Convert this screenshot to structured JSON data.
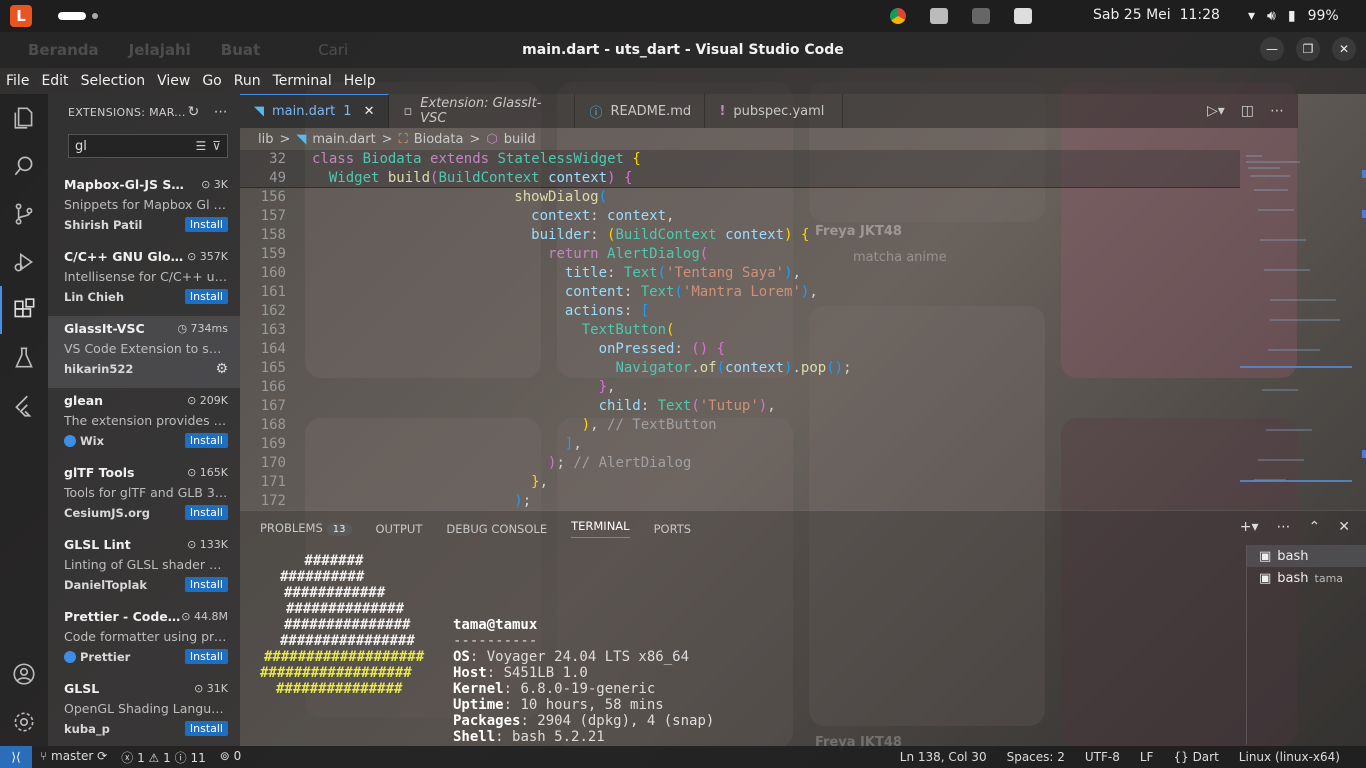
{
  "system_bar": {
    "date": "Sab 25 Mei",
    "time": "11:28",
    "battery": "99%"
  },
  "window": {
    "title": "main.dart - uts_dart - Visual Studio Code",
    "background_nav": [
      "Beranda",
      "Jelajahi",
      "Buat",
      "Cari"
    ],
    "background_names": [
      "Freya JKT48",
      "matcha anime",
      "Freya JKT48"
    ]
  },
  "menu": [
    "File",
    "Edit",
    "Selection",
    "View",
    "Go",
    "Run",
    "Terminal",
    "Help"
  ],
  "sidebar": {
    "title": "EXTENSIONS: MAR...",
    "search_value": "gl",
    "extensions": [
      {
        "name": "Mapbox-Gl-JS Sni...",
        "count": "3K",
        "desc": "Snippets for Mapbox Gl J...",
        "publisher": "Shirish Patil",
        "action": "Install",
        "verified": false
      },
      {
        "name": "C/C++ GNU Global",
        "count": "357K",
        "desc": "Intellisense for C/C++ usin...",
        "publisher": "Lin Chieh",
        "action": "Install",
        "verified": false
      },
      {
        "name": "GlassIt-VSC",
        "count": "734ms",
        "desc": "VS Code Extension to set ...",
        "publisher": "hikarin522",
        "action": "",
        "verified": false
      },
      {
        "name": "glean",
        "count": "209K",
        "desc": "The extension provides re...",
        "publisher": "Wix",
        "action": "Install",
        "verified": true
      },
      {
        "name": "glTF Tools",
        "count": "165K",
        "desc": "Tools for glTF and GLB 3D...",
        "publisher": "CesiumJS.org",
        "action": "Install",
        "verified": false
      },
      {
        "name": "GLSL Lint",
        "count": "133K",
        "desc": "Linting of GLSL shader code",
        "publisher": "DanielToplak",
        "action": "Install",
        "verified": false
      },
      {
        "name": "Prettier - Code ...",
        "count": "44.8M",
        "desc": "Code formatter using pre...",
        "publisher": "Prettier",
        "action": "Install",
        "verified": true
      },
      {
        "name": "GLSL",
        "count": "31K",
        "desc": "OpenGL Shading Languag...",
        "publisher": "kuba_p",
        "action": "Install",
        "verified": false
      }
    ]
  },
  "tabs": [
    {
      "label": "main.dart",
      "mod": "1",
      "close": "✕"
    },
    {
      "label": "Extension: GlassIt-VSC"
    },
    {
      "label": "README.md"
    },
    {
      "label": "pubspec.yaml"
    }
  ],
  "breadcrumb": [
    "lib",
    ">",
    "main.dart",
    ">",
    "Biodata",
    ">",
    "build"
  ],
  "lines": [
    "32",
    "49",
    "156",
    "157",
    "158",
    "159",
    "160",
    "161",
    "162",
    "163",
    "164",
    "165",
    "166",
    "167",
    "168",
    "169",
    "170",
    "171",
    "172"
  ],
  "panel": {
    "tabs": [
      "PROBLEMS",
      "OUTPUT",
      "DEBUG CONSOLE",
      "TERMINAL",
      "PORTS"
    ],
    "problems_count": "13",
    "terminals": [
      {
        "name": "bash",
        "sub": ""
      },
      {
        "name": "bash",
        "sub": "tama"
      }
    ]
  },
  "terminal": {
    "art": [
      " #######",
      "##########",
      "############",
      "##############",
      "###############",
      "################",
      "###################",
      "##################",
      "###############"
    ],
    "user": "tama@tamux",
    "sep": "----------",
    "info": [
      {
        "k": "OS",
        "v": "Voyager 24.04 LTS x86_64"
      },
      {
        "k": "Host",
        "v": "S451LB 1.0"
      },
      {
        "k": "Kernel",
        "v": "6.8.0-19-generic"
      },
      {
        "k": "Uptime",
        "v": "10 hours, 58 mins"
      },
      {
        "k": "Packages",
        "v": "2904 (dpkg), 4 (snap)"
      },
      {
        "k": "Shell",
        "v": "bash 5.2.21"
      }
    ]
  },
  "statusbar": {
    "branch": "master",
    "errors": "1",
    "warnings": "1",
    "info": "11",
    "ports": "0",
    "position": "Ln 138, Col 30",
    "spaces": "Spaces: 2",
    "encoding": "UTF-8",
    "eol": "LF",
    "language": "Dart",
    "platform": "Linux (linux-x64)"
  },
  "colors": {
    "accent": "#4a90e2",
    "install": "#1e6fc0",
    "art_yellow": "#e8e84a",
    "art_white": "#f0f0f0"
  }
}
